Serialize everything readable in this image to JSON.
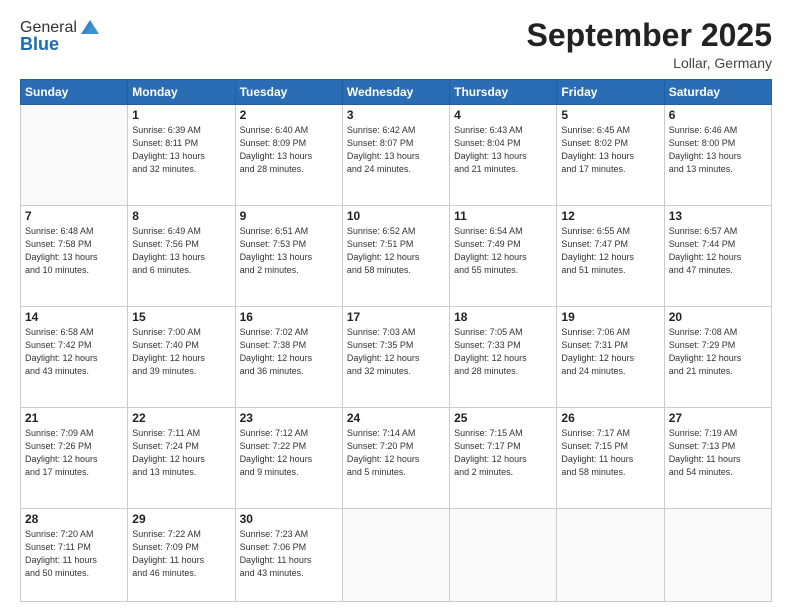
{
  "header": {
    "logo_general": "General",
    "logo_blue": "Blue",
    "month_title": "September 2025",
    "location": "Lollar, Germany"
  },
  "days_of_week": [
    "Sunday",
    "Monday",
    "Tuesday",
    "Wednesday",
    "Thursday",
    "Friday",
    "Saturday"
  ],
  "weeks": [
    [
      {
        "day": "",
        "info": ""
      },
      {
        "day": "1",
        "info": "Sunrise: 6:39 AM\nSunset: 8:11 PM\nDaylight: 13 hours\nand 32 minutes."
      },
      {
        "day": "2",
        "info": "Sunrise: 6:40 AM\nSunset: 8:09 PM\nDaylight: 13 hours\nand 28 minutes."
      },
      {
        "day": "3",
        "info": "Sunrise: 6:42 AM\nSunset: 8:07 PM\nDaylight: 13 hours\nand 24 minutes."
      },
      {
        "day": "4",
        "info": "Sunrise: 6:43 AM\nSunset: 8:04 PM\nDaylight: 13 hours\nand 21 minutes."
      },
      {
        "day": "5",
        "info": "Sunrise: 6:45 AM\nSunset: 8:02 PM\nDaylight: 13 hours\nand 17 minutes."
      },
      {
        "day": "6",
        "info": "Sunrise: 6:46 AM\nSunset: 8:00 PM\nDaylight: 13 hours\nand 13 minutes."
      }
    ],
    [
      {
        "day": "7",
        "info": "Sunrise: 6:48 AM\nSunset: 7:58 PM\nDaylight: 13 hours\nand 10 minutes."
      },
      {
        "day": "8",
        "info": "Sunrise: 6:49 AM\nSunset: 7:56 PM\nDaylight: 13 hours\nand 6 minutes."
      },
      {
        "day": "9",
        "info": "Sunrise: 6:51 AM\nSunset: 7:53 PM\nDaylight: 13 hours\nand 2 minutes."
      },
      {
        "day": "10",
        "info": "Sunrise: 6:52 AM\nSunset: 7:51 PM\nDaylight: 12 hours\nand 58 minutes."
      },
      {
        "day": "11",
        "info": "Sunrise: 6:54 AM\nSunset: 7:49 PM\nDaylight: 12 hours\nand 55 minutes."
      },
      {
        "day": "12",
        "info": "Sunrise: 6:55 AM\nSunset: 7:47 PM\nDaylight: 12 hours\nand 51 minutes."
      },
      {
        "day": "13",
        "info": "Sunrise: 6:57 AM\nSunset: 7:44 PM\nDaylight: 12 hours\nand 47 minutes."
      }
    ],
    [
      {
        "day": "14",
        "info": "Sunrise: 6:58 AM\nSunset: 7:42 PM\nDaylight: 12 hours\nand 43 minutes."
      },
      {
        "day": "15",
        "info": "Sunrise: 7:00 AM\nSunset: 7:40 PM\nDaylight: 12 hours\nand 39 minutes."
      },
      {
        "day": "16",
        "info": "Sunrise: 7:02 AM\nSunset: 7:38 PM\nDaylight: 12 hours\nand 36 minutes."
      },
      {
        "day": "17",
        "info": "Sunrise: 7:03 AM\nSunset: 7:35 PM\nDaylight: 12 hours\nand 32 minutes."
      },
      {
        "day": "18",
        "info": "Sunrise: 7:05 AM\nSunset: 7:33 PM\nDaylight: 12 hours\nand 28 minutes."
      },
      {
        "day": "19",
        "info": "Sunrise: 7:06 AM\nSunset: 7:31 PM\nDaylight: 12 hours\nand 24 minutes."
      },
      {
        "day": "20",
        "info": "Sunrise: 7:08 AM\nSunset: 7:29 PM\nDaylight: 12 hours\nand 21 minutes."
      }
    ],
    [
      {
        "day": "21",
        "info": "Sunrise: 7:09 AM\nSunset: 7:26 PM\nDaylight: 12 hours\nand 17 minutes."
      },
      {
        "day": "22",
        "info": "Sunrise: 7:11 AM\nSunset: 7:24 PM\nDaylight: 12 hours\nand 13 minutes."
      },
      {
        "day": "23",
        "info": "Sunrise: 7:12 AM\nSunset: 7:22 PM\nDaylight: 12 hours\nand 9 minutes."
      },
      {
        "day": "24",
        "info": "Sunrise: 7:14 AM\nSunset: 7:20 PM\nDaylight: 12 hours\nand 5 minutes."
      },
      {
        "day": "25",
        "info": "Sunrise: 7:15 AM\nSunset: 7:17 PM\nDaylight: 12 hours\nand 2 minutes."
      },
      {
        "day": "26",
        "info": "Sunrise: 7:17 AM\nSunset: 7:15 PM\nDaylight: 11 hours\nand 58 minutes."
      },
      {
        "day": "27",
        "info": "Sunrise: 7:19 AM\nSunset: 7:13 PM\nDaylight: 11 hours\nand 54 minutes."
      }
    ],
    [
      {
        "day": "28",
        "info": "Sunrise: 7:20 AM\nSunset: 7:11 PM\nDaylight: 11 hours\nand 50 minutes."
      },
      {
        "day": "29",
        "info": "Sunrise: 7:22 AM\nSunset: 7:09 PM\nDaylight: 11 hours\nand 46 minutes."
      },
      {
        "day": "30",
        "info": "Sunrise: 7:23 AM\nSunset: 7:06 PM\nDaylight: 11 hours\nand 43 minutes."
      },
      {
        "day": "",
        "info": ""
      },
      {
        "day": "",
        "info": ""
      },
      {
        "day": "",
        "info": ""
      },
      {
        "day": "",
        "info": ""
      }
    ]
  ]
}
